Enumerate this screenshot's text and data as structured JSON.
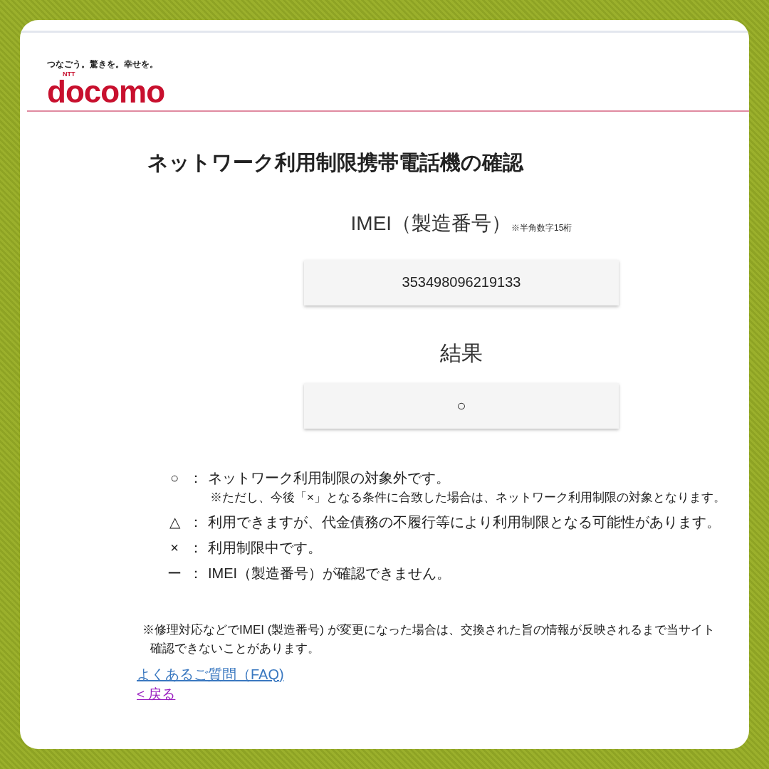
{
  "header": {
    "tagline": "つなごう。驚きを。幸せを。",
    "logo_small": "NTT",
    "logo": "docomo"
  },
  "title": "ネットワーク利用制限携帯電話機の確認",
  "imei": {
    "label": "IMEI（製造番号）",
    "note": "※半角数字15桁",
    "value": "353498096219133"
  },
  "result": {
    "label": "結果",
    "value": "○"
  },
  "legend": [
    {
      "symbol": "○",
      "separator": "：",
      "text": "ネットワーク利用制限の対象外です。",
      "note": "※ただし、今後「×」となる条件に合致した場合は、ネットワーク利用制限の対象となります。"
    },
    {
      "symbol": "△",
      "separator": "：",
      "text": "利用できますが、代金債務の不履行等により利用制限となる可能性があります。"
    },
    {
      "symbol": "×",
      "separator": "：",
      "text": "利用制限中です。"
    },
    {
      "symbol": "ー",
      "separator": "：",
      "text": "IMEI（製造番号）が確認できません。"
    }
  ],
  "footnote": [
    "※修理対応などでIMEI (製造番号) が変更になった場合は、交換された旨の情報が反映されるまで当サイト",
    "確認できないことがあります。"
  ],
  "links": [
    {
      "label": "よくあるご質問（FAQ)",
      "visited": false
    },
    {
      "label": "< 戻る",
      "visited": true
    }
  ]
}
